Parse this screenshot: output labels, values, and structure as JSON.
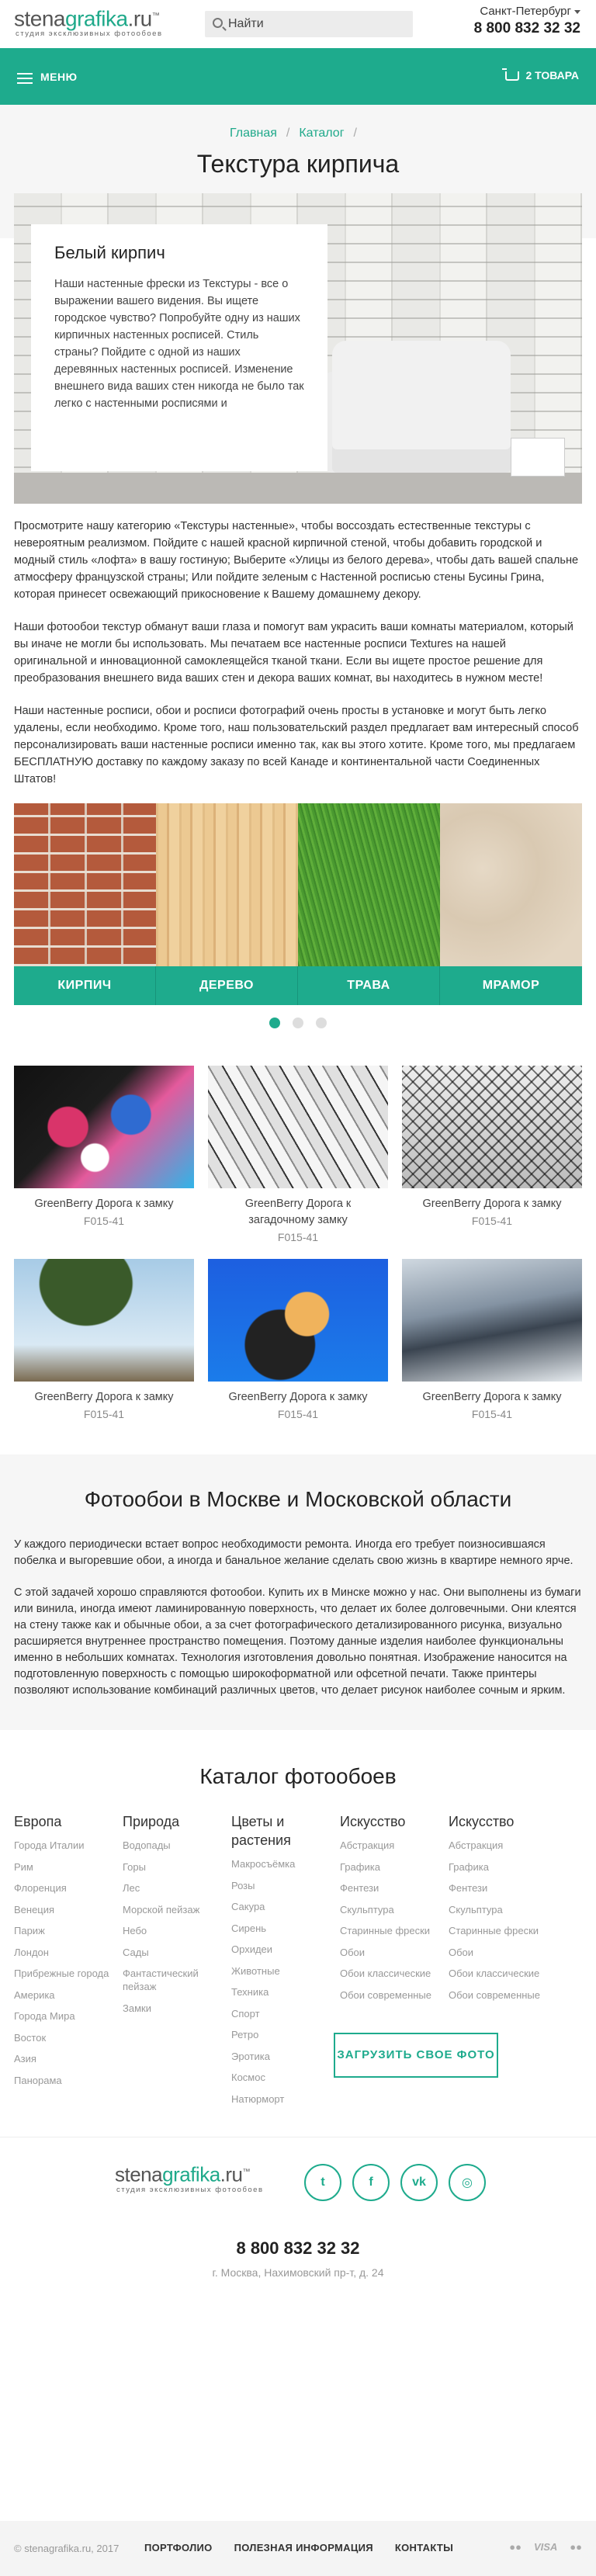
{
  "header": {
    "logo_main": "stena",
    "logo_accent": "grafika",
    "logo_tld": ".ru",
    "logo_tagline": "студия эксклюзивных фотообоев",
    "search_placeholder": "Найти",
    "city": "Санкт-Петербург",
    "phone": "8 800 832 32 32"
  },
  "menubar": {
    "menu_label": "МЕНЮ",
    "cart_label": "2 ТОВАРА"
  },
  "breadcrumbs": [
    "Главная",
    "Каталог"
  ],
  "page_title": "Текстура кирпича",
  "hero": {
    "card_title": "Белый кирпич",
    "card_text": "Наши настенные фрески из Текстуры - все о выражении вашего видения. Вы ищете городское чувство? Попробуйте одну из наших кирпичных настенных росписей. Стиль страны? Пойдите с одной из наших деревянных настенных росписей. Изменение внешнего вида ваших стен никогда не было так легко с настенными росписями и"
  },
  "description": [
    "Просмотрите нашу категорию «Текстуры настенные», чтобы воссоздать естественные текстуры с невероятным реализмом. Пойдите с нашей красной кирпичной стеной, чтобы добавить городской и модный стиль «лофта» в вашу гостиную; Выберите «Улицы из белого дерева», чтобы дать вашей спальне атмосферу французской страны; Или пойдите зеленым с Настенной росписью стены Бусины Грина, которая принесет освежающий прикосновение к Вашему домашнему декору.",
    "Наши фотообои текстур обманут ваши глаза и помогут вам украсить ваши комнаты материалом, который вы иначе не могли бы использовать. Мы печатаем все настенные росписи Textures на нашей оригинальной и инновационной самоклеящейся тканой ткани. Если вы ищете простое решение для преобразования внешнего вида ваших стен и декора ваших комнат, вы находитесь в нужном месте!",
    "Наши настенные росписи, обои и росписи фотографий очень просты в установке и могут быть легко удалены, если необходимо. Кроме того, наш пользовательский раздел предлагает вам интересный способ персонализировать ваши настенные росписи именно так, как вы этого хотите. Кроме того, мы предлагаем БЕСПЛАТНУЮ доставку по каждому заказу по всей Канаде и континентальной части Соединенных Штатов!"
  ],
  "textures": [
    {
      "label": "КИРПИЧ"
    },
    {
      "label": "ДЕРЕВО"
    },
    {
      "label": "ТРАВА"
    },
    {
      "label": "МРАМОР"
    }
  ],
  "slider": {
    "count": 3,
    "active": 0
  },
  "products": [
    {
      "name": "GreenBerry Дорога к замку",
      "code": "F015-41"
    },
    {
      "name": "GreenBerry Дорога к загадочному замку",
      "code": "F015-41"
    },
    {
      "name": "GreenBerry Дорога к замку",
      "code": "F015-41"
    },
    {
      "name": "GreenBerry Дорога к замку",
      "code": "F015-41"
    },
    {
      "name": "GreenBerry Дорога к замку",
      "code": "F015-41"
    },
    {
      "name": "GreenBerry Дорога к замку",
      "code": "F015-41"
    }
  ],
  "moscow": {
    "title": "Фотообои в Москве и Московской области",
    "p1": "У каждого периодически встает вопрос необходимости ремонта. Иногда его требует поизносившаяся побелка и выгоревшие обои, а иногда и банальное желание сделать свою жизнь в квартире немного ярче.",
    "p2": "С этой задачей хорошо справляются фотообои. Купить их в Минске можно у нас. Они выполнены из бумаги или винила, иногда имеют ламинированную поверхность, что делает их более долговечными. Они клеятся на стену также как и обычные обои, а за счет фотографического детализированного рисунка, визуально расширяется внутреннее пространство помещения. Поэтому данные изделия наиболее функциональны именно в небольших комнатах. Технология изготовления довольно понятная. Изображение наносится на подготовленную поверхность с помощью широкоформатной или офсетной печати. Также принтеры позволяют использование комбинаций различных цветов, что делает рисунок наиболее сочным и ярким."
  },
  "catalog": {
    "title": "Каталог фотообоев",
    "columns": [
      {
        "heading": "Европа",
        "items": [
          "Города Италии",
          "Рим",
          "Флоренция",
          "Венеция",
          "Париж",
          "Лондон",
          "Прибрежные города",
          "Америка",
          "Города Мира",
          "Восток",
          "Азия",
          "Панорама"
        ]
      },
      {
        "heading": "Природа",
        "items": [
          "Водопады",
          "Горы",
          "Лес",
          "Морской пейзаж",
          "Небо",
          "Сады",
          "Фантастический пейзаж",
          "Замки"
        ]
      },
      {
        "heading": "Цветы и растения",
        "items": [
          "Макросъёмка",
          "Розы",
          "Сакура",
          "Сирень",
          "Орхидеи",
          "Животные",
          "Техника",
          "Спорт",
          "Ретро",
          "Эротика",
          "Космос",
          "Натюрморт"
        ]
      },
      {
        "heading": "Искусство",
        "items": [
          "Абстракция",
          "Графика",
          "Фентези",
          "Скульптура",
          "Старинные фрески",
          "Обои",
          "Обои классические",
          "Обои современные"
        ]
      },
      {
        "heading": "Искусство",
        "items": [
          "Абстракция",
          "Графика",
          "Фентези",
          "Скульптура",
          "Старинные фрески",
          "Обои",
          "Обои классические",
          "Обои современные"
        ]
      }
    ],
    "upload_button": "ЗАГРУЗИТЬ СВОЕ ФОТО"
  },
  "footer": {
    "phone": "8 800 832 32 32",
    "address": "г. Москва, Нахимовский пр-т, д. 24",
    "social": [
      {
        "icon": "twitter-icon",
        "glyph": "t"
      },
      {
        "icon": "facebook-icon",
        "glyph": "f"
      },
      {
        "icon": "vk-icon",
        "glyph": "vk"
      },
      {
        "icon": "instagram-icon",
        "glyph": "◎"
      }
    ],
    "copyright": "© stenagrafika.ru, 2017",
    "links": [
      "ПОРТФОЛИО",
      "ПОЛЕЗНАЯ ИНФОРМАЦИЯ",
      "КОНТАКТЫ"
    ],
    "payments": [
      "●●",
      "VISA",
      "●●"
    ]
  },
  "colors": {
    "accent": "#1eab8d"
  }
}
